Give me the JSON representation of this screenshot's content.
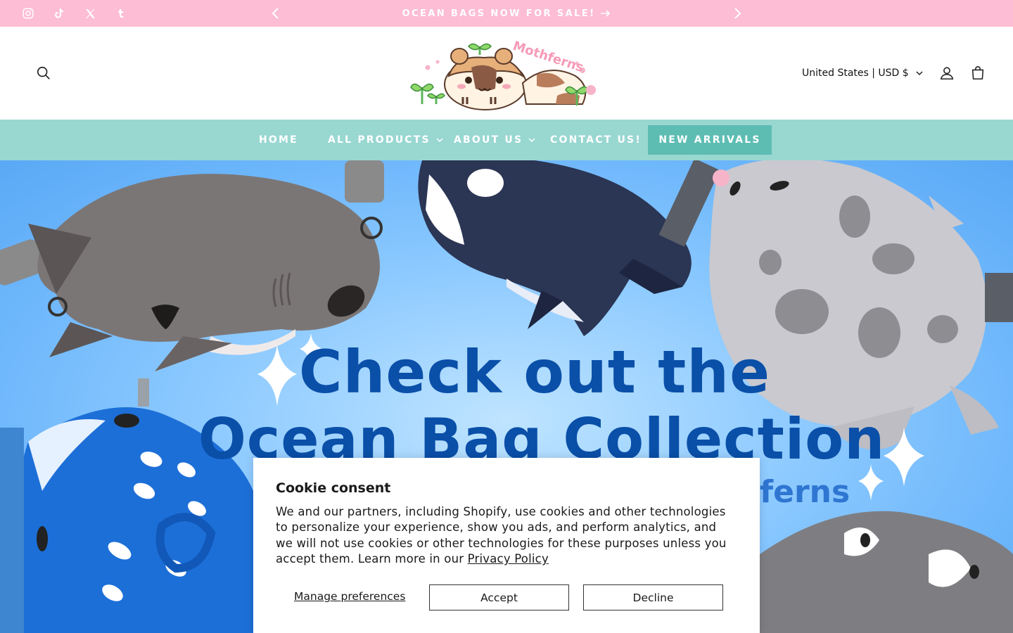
{
  "announcement": {
    "text": "OCEAN BAGS NOW FOR SALE!",
    "prev_icon": "chevron-left-icon",
    "next_icon": "chevron-right-icon"
  },
  "social": [
    "instagram-icon",
    "tiktok-icon",
    "x-icon",
    "tumblr-icon"
  ],
  "header": {
    "logo_text": "Mothferns",
    "currency": "United States | USD $",
    "icons": [
      "search-icon",
      "account-icon",
      "cart-icon"
    ]
  },
  "nav": {
    "items": [
      {
        "label": "HOME"
      },
      {
        "label": "ALL PRODUCTS"
      },
      {
        "label": "ABOUT US"
      },
      {
        "label": "CONTACT US!"
      },
      {
        "label": "NEW ARRIVALS"
      }
    ]
  },
  "hero": {
    "line1": "Check out the",
    "line2": "Ocean Bag Collection",
    "line3": "ferns"
  },
  "cookie": {
    "title": "Cookie consent",
    "body": "We and our partners, including Shopify, use cookies and other technologies to personalize your experience, show you ads, and perform analytics, and we will not use cookies or other technologies for these purposes unless you accept them. Learn more in our ",
    "link": "Privacy Policy",
    "manage": "Manage preferences",
    "accept": "Accept",
    "decline": "Decline"
  },
  "colors": {
    "announcement_bg": "#fcbdd5",
    "nav_bg": "#99d7d1",
    "nav_highlight": "#5ebdb3",
    "hero_text": "#0a4fa8"
  }
}
